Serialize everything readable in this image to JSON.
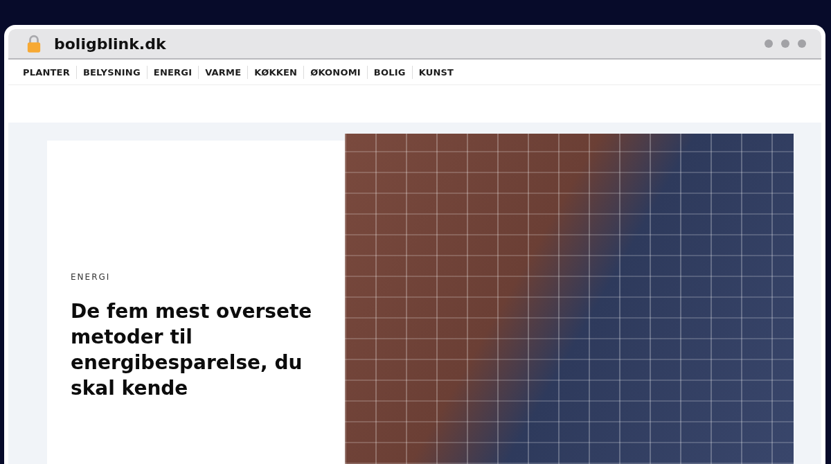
{
  "browser": {
    "address": "boligblink.dk"
  },
  "nav": {
    "items": [
      {
        "label": "PLANTER"
      },
      {
        "label": "BELYSNING"
      },
      {
        "label": "ENERGI"
      },
      {
        "label": "VARME"
      },
      {
        "label": "KØKKEN"
      },
      {
        "label": "ØKONOMI"
      },
      {
        "label": "BOLIG"
      },
      {
        "label": "KUNST"
      }
    ]
  },
  "article": {
    "category": "ENERGI",
    "title": "De fem mest oversete metoder til energibesparelse, du skal kende"
  }
}
